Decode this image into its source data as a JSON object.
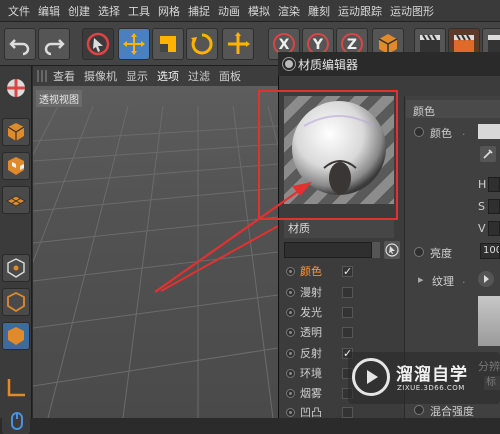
{
  "menu": {
    "items": [
      "文件",
      "编辑",
      "创建",
      "选择",
      "工具",
      "网格",
      "捕捉",
      "动画",
      "模拟",
      "渲染",
      "雕刻",
      "运动跟踪",
      "运动图形"
    ]
  },
  "viewport": {
    "menu": [
      "查看",
      "摄像机",
      "显示",
      "选项",
      "过滤",
      "面板"
    ],
    "label": "透视视图"
  },
  "material_editor": {
    "title": "材质编辑器",
    "material_label": "材质",
    "channels": [
      {
        "label": "颜色",
        "checked": true,
        "active": true
      },
      {
        "label": "漫射",
        "checked": false,
        "active": false
      },
      {
        "label": "发光",
        "checked": false,
        "active": false
      },
      {
        "label": "透明",
        "checked": false,
        "active": false
      },
      {
        "label": "反射",
        "checked": true,
        "active": false
      },
      {
        "label": "环境",
        "checked": false,
        "active": false
      },
      {
        "label": "烟雾",
        "checked": false,
        "active": false
      },
      {
        "label": "凹凸",
        "checked": false,
        "active": false
      }
    ],
    "attributes": {
      "section_title": "颜色",
      "color_label": "颜色",
      "h_label": "H",
      "s_label": "S",
      "v_label": "V",
      "brightness_label": "亮度",
      "brightness_value": "100",
      "texture_label": "纹理",
      "split_label": "分辨",
      "mode_label": "标",
      "blend_label": "混合强度"
    }
  },
  "check_mark": "✓",
  "watermark": {
    "brand": "溜溜自学",
    "url": "ZIXUE.3D66.COM"
  },
  "colors": {
    "accent_orange": "#ff9a3c",
    "highlight_red": "#e53030",
    "toolbar_blue": "#4a7fc0"
  }
}
